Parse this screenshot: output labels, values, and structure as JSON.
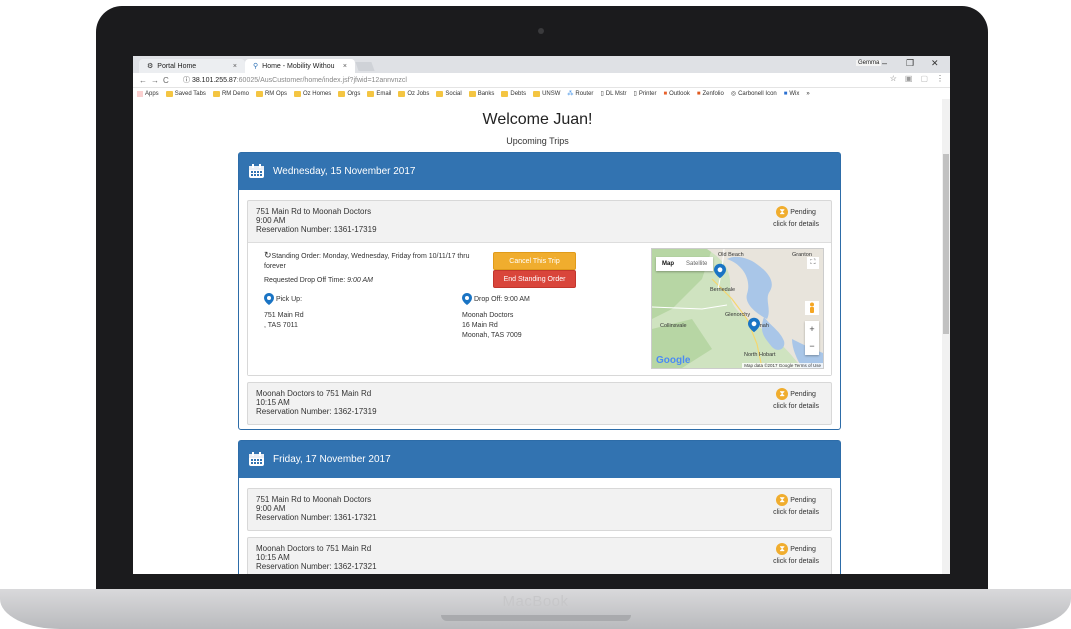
{
  "device": {
    "brand": "MacBook"
  },
  "browser": {
    "tabs": [
      {
        "title": "Portal Home",
        "icon": "gear-globe-icon"
      },
      {
        "title": "Home - Mobility Withou",
        "icon": "pin-icon"
      }
    ],
    "window_user": "Gemma",
    "url_host": "38.101.255.87",
    "url_path": ":60025/AusCustomer/home/index.jsf?jfwid=12annvnzcl",
    "bookmarks": [
      "Apps",
      "Saved Tabs",
      "RM Demo",
      "RM Ops",
      "Oz Homes",
      "Orgs",
      "Email",
      "Oz Jobs",
      "Social",
      "Banks",
      "Debts",
      "UNSW",
      "Router",
      "DL Mstr",
      "Printer",
      "Outlook",
      "Zenfolio",
      "Carbonell Icon",
      "Wix"
    ],
    "bookmarks_more": "»"
  },
  "page": {
    "welcome": "Welcome Juan!",
    "subtitle": "Upcoming Trips",
    "days": [
      {
        "date": "Wednesday, 15 November 2017",
        "trips": [
          {
            "route": "751 Main Rd to Moonah Doctors",
            "time": "9:00 AM",
            "reservation": "Reservation Number: 1361-17319",
            "status": "Pending",
            "details_link": "click for details",
            "expanded": {
              "standing_order": "Standing Order: Monday, Wednesday, Friday from 10/11/17 thru forever",
              "requested_drop_label": "Requested Drop Off Time:",
              "requested_drop_time": "9:00 AM",
              "pickup_label": "Pick Up:",
              "pickup_line1": "751 Main Rd",
              "pickup_line2": ", TAS 7011",
              "dropoff_label": "Drop Off: 9:00 AM",
              "dropoff_line1": "Moonah Doctors",
              "dropoff_line2": "16 Main Rd",
              "dropoff_line3": "Moonah, TAS 7009",
              "cancel_button": "Cancel This Trip",
              "end_button": "End Standing Order",
              "map": {
                "type_map": "Map",
                "type_satellite": "Satellite",
                "places": [
                  "Old Beach",
                  "Granton",
                  "Berriedale",
                  "Glenorchy",
                  "Collinsvale",
                  "Moonah",
                  "North Hobart"
                ],
                "logo": "Google",
                "attribution": "Map data ©2017 Google  Terms of Use",
                "zoom_in": "+",
                "zoom_out": "−"
              }
            }
          },
          {
            "route": "Moonah Doctors to 751 Main Rd",
            "time": "10:15 AM",
            "reservation": "Reservation Number: 1362-17319",
            "status": "Pending",
            "details_link": "click for details"
          }
        ]
      },
      {
        "date": "Friday, 17 November 2017",
        "trips": [
          {
            "route": "751 Main Rd to Moonah Doctors",
            "time": "9:00 AM",
            "reservation": "Reservation Number: 1361-17321",
            "status": "Pending",
            "details_link": "click for details"
          },
          {
            "route": "Moonah Doctors to 751 Main Rd",
            "time": "10:15 AM",
            "reservation": "Reservation Number: 1362-17321",
            "status": "Pending",
            "details_link": "click for details"
          }
        ]
      }
    ]
  },
  "colors": {
    "header_blue": "#3273b1",
    "pending_orange": "#f0ad2e",
    "end_red": "#d9453b"
  }
}
